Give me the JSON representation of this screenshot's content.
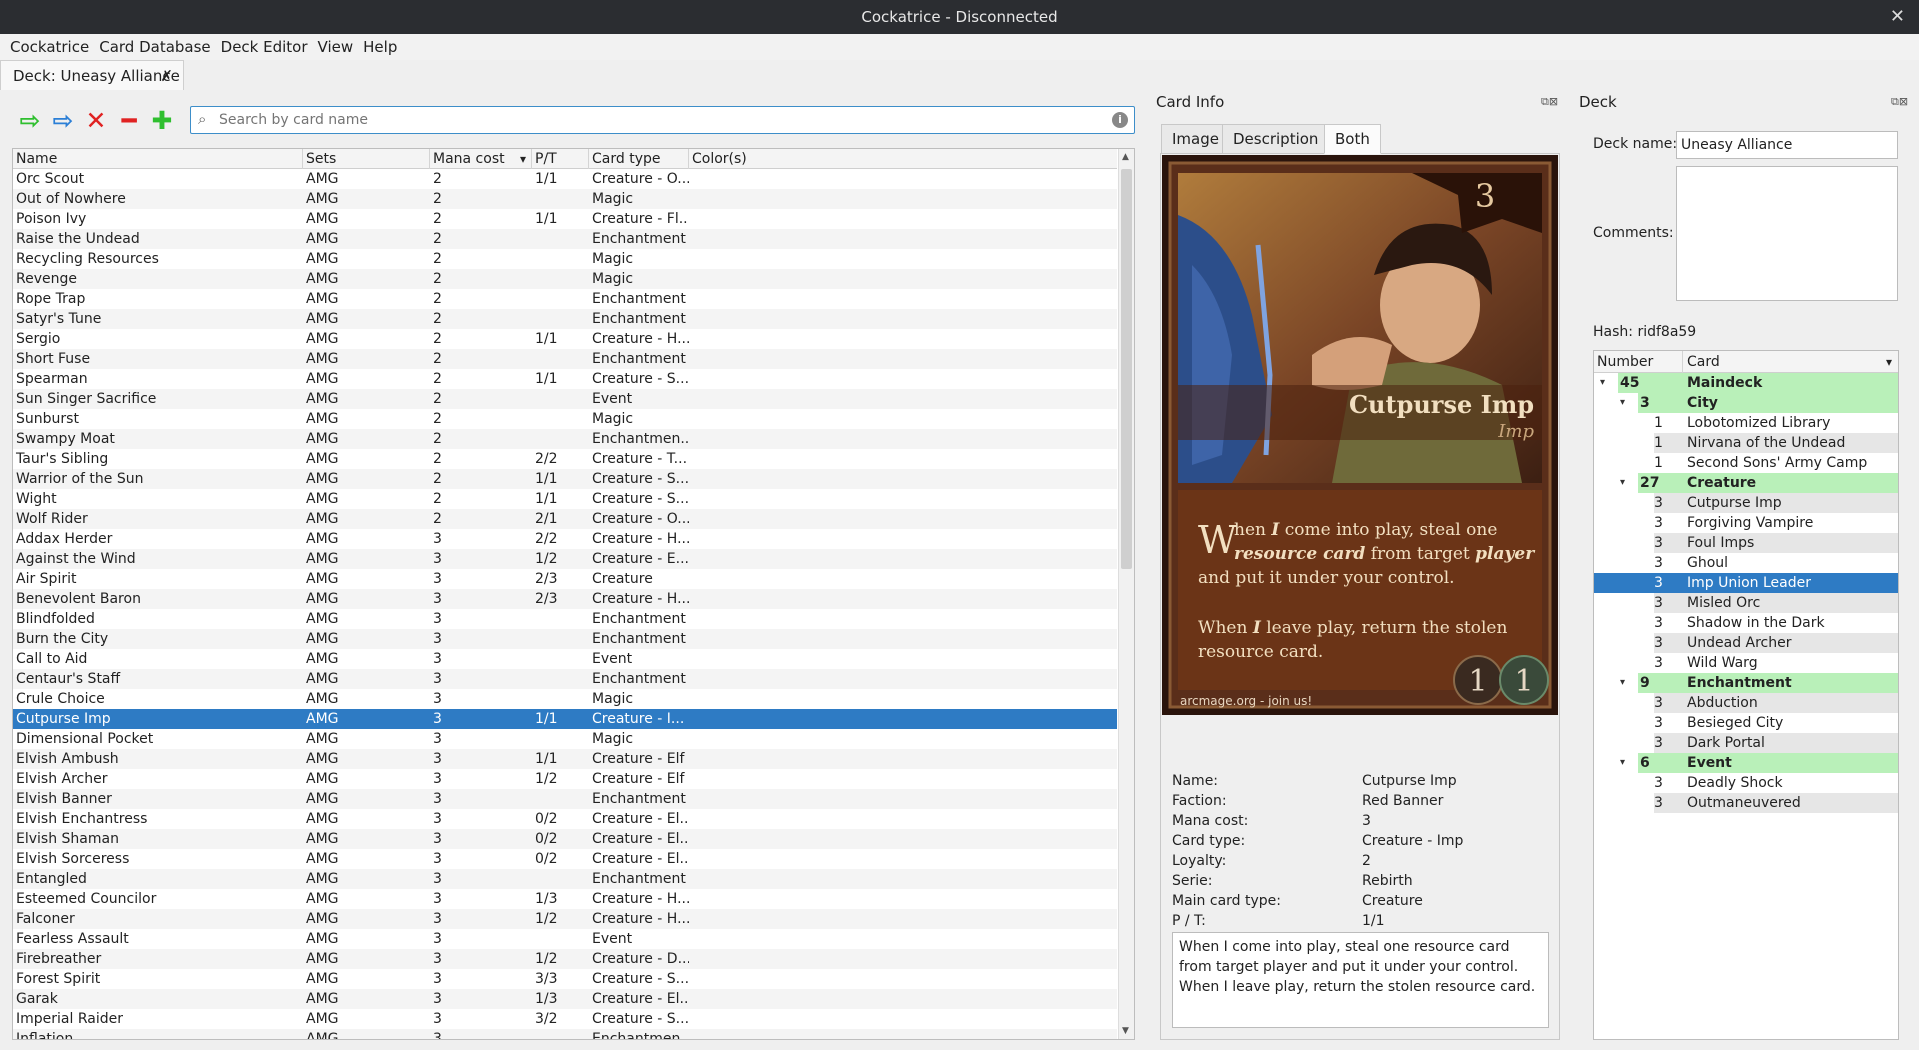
{
  "window": {
    "title": "Cockatrice - Disconnected",
    "close_glyph": "✕"
  },
  "menu": [
    "Cockatrice",
    "Card Database",
    "Deck Editor",
    "View",
    "Help"
  ],
  "tab": {
    "label": "Deck: Uneasy Alliance",
    "close_glyph": "✗"
  },
  "toolbar": {
    "glyphs": {
      "add_main": "⇨",
      "add_side": "⇨",
      "remove": "✕",
      "decrement": "━",
      "increment": "✚"
    },
    "colors": {
      "add_main": "#2fbf2f",
      "add_side": "#2b7fd6",
      "remove": "#e02222",
      "decrement": "#e02222",
      "increment": "#2fbf2f"
    }
  },
  "search": {
    "placeholder": "Search by card name",
    "value": "",
    "mag_glyph": "⌕",
    "info_glyph": "i"
  },
  "card_table": {
    "headers": [
      "Name",
      "Sets",
      "Mana cost",
      "P/T",
      "Card type",
      "Color(s)"
    ],
    "sort_glyph": "▾",
    "selected_index": 27,
    "rows": [
      [
        "Orc Scout",
        "AMG",
        "2",
        "1/1",
        "Creature - O..."
      ],
      [
        "Out of Nowhere",
        "AMG",
        "2",
        "",
        "Magic"
      ],
      [
        "Poison Ivy",
        "AMG",
        "2",
        "1/1",
        "Creature - Fl..."
      ],
      [
        "Raise the Undead",
        "AMG",
        "2",
        "",
        "Enchantment"
      ],
      [
        "Recycling Resources",
        "AMG",
        "2",
        "",
        "Magic"
      ],
      [
        "Revenge",
        "AMG",
        "2",
        "",
        "Magic"
      ],
      [
        "Rope Trap",
        "AMG",
        "2",
        "",
        "Enchantment"
      ],
      [
        "Satyr's Tune",
        "AMG",
        "2",
        "",
        "Enchantment"
      ],
      [
        "Sergio",
        "AMG",
        "2",
        "1/1",
        "Creature - H..."
      ],
      [
        "Short Fuse",
        "AMG",
        "2",
        "",
        "Enchantment"
      ],
      [
        "Spearman",
        "AMG",
        "2",
        "1/1",
        "Creature - S..."
      ],
      [
        "Sun Singer Sacrifice",
        "AMG",
        "2",
        "",
        "Event"
      ],
      [
        "Sunburst",
        "AMG",
        "2",
        "",
        "Magic"
      ],
      [
        "Swampy Moat",
        "AMG",
        "2",
        "",
        "Enchantmen..."
      ],
      [
        "Taur's Sibling",
        "AMG",
        "2",
        "2/2",
        "Creature - T..."
      ],
      [
        "Warrior of the Sun",
        "AMG",
        "2",
        "1/1",
        "Creature - S..."
      ],
      [
        "Wight",
        "AMG",
        "2",
        "1/1",
        "Creature - S..."
      ],
      [
        "Wolf Rider",
        "AMG",
        "2",
        "2/1",
        "Creature - O..."
      ],
      [
        "Addax Herder",
        "AMG",
        "3",
        "2/2",
        "Creature - H..."
      ],
      [
        "Against the Wind",
        "AMG",
        "3",
        "1/2",
        "Creature - E..."
      ],
      [
        "Air Spirit",
        "AMG",
        "3",
        "2/3",
        "Creature"
      ],
      [
        "Benevolent Baron",
        "AMG",
        "3",
        "2/3",
        "Creature - H..."
      ],
      [
        "Blindfolded",
        "AMG",
        "3",
        "",
        "Enchantment"
      ],
      [
        "Burn the City",
        "AMG",
        "3",
        "",
        "Enchantment"
      ],
      [
        "Call to Aid",
        "AMG",
        "3",
        "",
        "Event"
      ],
      [
        "Centaur's Staff",
        "AMG",
        "3",
        "",
        "Enchantment"
      ],
      [
        "Crule Choice",
        "AMG",
        "3",
        "",
        "Magic"
      ],
      [
        "Cutpurse Imp",
        "AMG",
        "3",
        "1/1",
        "Creature - I..."
      ],
      [
        "Dimensional Pocket",
        "AMG",
        "3",
        "",
        "Magic"
      ],
      [
        "Elvish Ambush",
        "AMG",
        "3",
        "1/1",
        "Creature - Elf"
      ],
      [
        "Elvish Archer",
        "AMG",
        "3",
        "1/2",
        "Creature - Elf"
      ],
      [
        "Elvish Banner",
        "AMG",
        "3",
        "",
        "Enchantment"
      ],
      [
        "Elvish Enchantress",
        "AMG",
        "3",
        "0/2",
        "Creature - El..."
      ],
      [
        "Elvish Shaman",
        "AMG",
        "3",
        "0/2",
        "Creature - El..."
      ],
      [
        "Elvish Sorceress",
        "AMG",
        "3",
        "0/2",
        "Creature - El..."
      ],
      [
        "Entangled",
        "AMG",
        "3",
        "",
        "Enchantment"
      ],
      [
        "Esteemed Councilor",
        "AMG",
        "3",
        "1/3",
        "Creature - H..."
      ],
      [
        "Falconer",
        "AMG",
        "3",
        "1/2",
        "Creature - H..."
      ],
      [
        "Fearless Assault",
        "AMG",
        "3",
        "",
        "Event"
      ],
      [
        "Firebreather",
        "AMG",
        "3",
        "1/2",
        "Creature - D..."
      ],
      [
        "Forest Spirit",
        "AMG",
        "3",
        "3/3",
        "Creature - S..."
      ],
      [
        "Garak",
        "AMG",
        "3",
        "1/3",
        "Creature - El..."
      ],
      [
        "Imperial Raider",
        "AMG",
        "3",
        "3/2",
        "Creature - S..."
      ],
      [
        "Inflation",
        "AMG",
        "3",
        "",
        "Enchantmen..."
      ]
    ]
  },
  "card_info": {
    "title": "Card Info",
    "dock_glyphs": "⧉⊠",
    "tabs": [
      "Image",
      "Description",
      "Both"
    ],
    "active_tab": 2,
    "image": {
      "cost": "3",
      "name": "Cutpurse Imp",
      "subtype": "Imp",
      "rules_line1_lead": "W",
      "rules_line1_rest": "hen ",
      "rules_I": "I",
      "rules_line1_tail": " come into play, steal one",
      "rules_line2_b": "resource card",
      "rules_line2_mid": " from target ",
      "rules_line2_player": "player",
      "rules_line3": "and put it under your control.",
      "rules_line4_a": "When ",
      "rules_line4_I": "I",
      "rules_line4_b": " leave play, return the stolen",
      "rules_line5": "resource card.",
      "power": "1",
      "toughness": "1",
      "footer": "arcmage.org - join us!"
    },
    "fields": [
      {
        "label": "Name:",
        "value": "Cutpurse Imp"
      },
      {
        "label": "Faction:",
        "value": "Red Banner"
      },
      {
        "label": "Mana cost:",
        "value": "3"
      },
      {
        "label": "Card type:",
        "value": "Creature - Imp"
      },
      {
        "label": "Loyalty:",
        "value": "2"
      },
      {
        "label": "Serie:",
        "value": "Rebirth"
      },
      {
        "label": "Main card type:",
        "value": "Creature"
      },
      {
        "label": "P / T:",
        "value": "1/1"
      }
    ],
    "rules_text": "When I come into play, steal one resource card from target player and put it under your control. When I leave play, return the stolen resource card."
  },
  "deck": {
    "title": "Deck",
    "dock_glyphs": "⧉⊠",
    "name_label": "Deck name:",
    "name_value": "Uneasy Alliance",
    "comments_label": "Comments:",
    "hash_label": "Hash:",
    "hash_value": "ridf8a59",
    "tree_headers": [
      "Number",
      "Card"
    ],
    "tree_sort_glyph": "▾",
    "expand_glyph": "▾",
    "selected_row": 10,
    "tree": [
      {
        "level": 0,
        "num": "45",
        "name": "Maindeck"
      },
      {
        "level": 1,
        "num": "3",
        "name": "City"
      },
      {
        "level": 2,
        "num": "1",
        "name": "Lobotomized Library"
      },
      {
        "level": 2,
        "num": "1",
        "name": "Nirvana of the Undead"
      },
      {
        "level": 2,
        "num": "1",
        "name": "Second Sons' Army Camp"
      },
      {
        "level": 1,
        "num": "27",
        "name": "Creature"
      },
      {
        "level": 2,
        "num": "3",
        "name": "Cutpurse Imp"
      },
      {
        "level": 2,
        "num": "3",
        "name": "Forgiving Vampire"
      },
      {
        "level": 2,
        "num": "3",
        "name": "Foul Imps"
      },
      {
        "level": 2,
        "num": "3",
        "name": "Ghoul"
      },
      {
        "level": 2,
        "num": "3",
        "name": "Imp Union Leader"
      },
      {
        "level": 2,
        "num": "3",
        "name": "Misled Orc"
      },
      {
        "level": 2,
        "num": "3",
        "name": "Shadow in the Dark"
      },
      {
        "level": 2,
        "num": "3",
        "name": "Undead Archer"
      },
      {
        "level": 2,
        "num": "3",
        "name": "Wild Warg"
      },
      {
        "level": 1,
        "num": "9",
        "name": "Enchantment"
      },
      {
        "level": 2,
        "num": "3",
        "name": "Abduction"
      },
      {
        "level": 2,
        "num": "3",
        "name": "Besieged City"
      },
      {
        "level": 2,
        "num": "3",
        "name": "Dark Portal"
      },
      {
        "level": 1,
        "num": "6",
        "name": "Event"
      },
      {
        "level": 2,
        "num": "3",
        "name": "Deadly Shock"
      },
      {
        "level": 2,
        "num": "3",
        "name": "Outmaneuvered"
      }
    ]
  }
}
